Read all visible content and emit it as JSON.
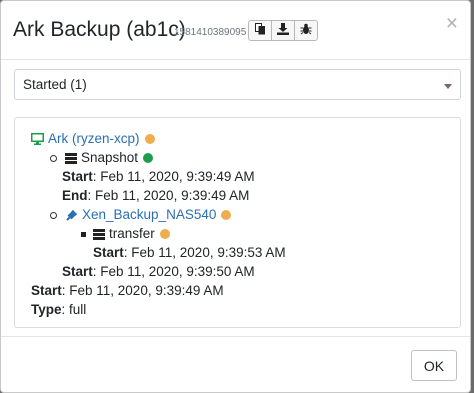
{
  "dialog": {
    "title": "Ark Backup (ab1c)",
    "timestamp": "1581410389095",
    "toolbar": [
      {
        "icon": "copy-icon"
      },
      {
        "icon": "download-icon"
      },
      {
        "icon": "bug-icon"
      }
    ],
    "close_label": "×"
  },
  "filter": {
    "selected": "Started (1)"
  },
  "log": {
    "root": {
      "name": "Ark (ryzen-xcp)",
      "status_color": "#f0ad4e",
      "icon": "monitor-icon"
    },
    "snapshot": {
      "name": "Snapshot",
      "status_color": "#1e9e4b",
      "icon": "server-icon",
      "start_label": "Start",
      "start_value": ": Feb 11, 2020, 9:39:49 AM",
      "end_label": "End",
      "end_value": ": Feb 11, 2020, 9:39:49 AM"
    },
    "remote": {
      "name": "Xen_Backup_NAS540",
      "status_color": "#f0ad4e",
      "icon": "plug-icon",
      "transfer": {
        "name": "transfer",
        "status_color": "#f0ad4e",
        "icon": "server-icon",
        "start_label": "Start",
        "start_value": ": Feb 11, 2020, 9:39:53 AM"
      },
      "start_label": "Start",
      "start_value": ": Feb 11, 2020, 9:39:50 AM"
    },
    "start_label": "Start",
    "start_value": ": Feb 11, 2020, 9:39:49 AM",
    "type_label": "Type",
    "type_value": ": full"
  },
  "footer": {
    "ok_label": "OK"
  }
}
